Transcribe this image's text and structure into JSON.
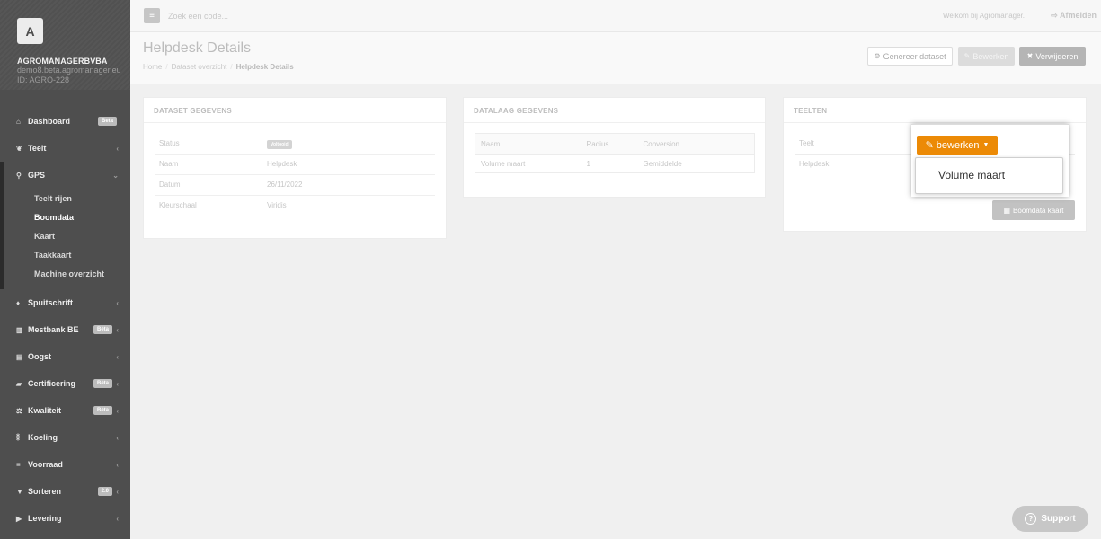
{
  "sidebar": {
    "logo": "A",
    "company": "AGROMANAGERBVBA",
    "email": "demo8.beta.agromanager.eu",
    "id": "ID: AGRO-228",
    "items": [
      {
        "label": "Dashboard",
        "badge": "Beta",
        "icon": "home-icon"
      },
      {
        "label": "Teelt",
        "icon": "leaf-icon"
      },
      {
        "label": "GPS",
        "icon": "map-marker-icon"
      },
      {
        "label": "Spuitschrift",
        "icon": "drop-icon"
      },
      {
        "label": "Mestbank BE",
        "badge": "Bèta",
        "icon": "bank-icon"
      },
      {
        "label": "Oogst",
        "icon": "basket-icon"
      },
      {
        "label": "Certificering",
        "badge": "Bèta",
        "icon": "book-icon"
      },
      {
        "label": "Kwaliteit",
        "badge": "Bèta",
        "icon": "balance-icon"
      },
      {
        "label": "Koeling",
        "icon": "thermometer-icon"
      },
      {
        "label": "Voorraad",
        "icon": "list-icon"
      },
      {
        "label": "Sorteren",
        "badge": "2.0",
        "icon": "filter-icon"
      },
      {
        "label": "Levering",
        "icon": "truck-icon"
      }
    ],
    "gps_sub": [
      "Teelt rijen",
      "Boomdata",
      "Kaart",
      "Taakkaart",
      "Machine overzicht"
    ]
  },
  "topbar": {
    "search_placeholder": "Zoek een code...",
    "welcome": "Welkom bij Agromanager.",
    "logout": "Afmelden"
  },
  "header": {
    "title": "Helpdesk Details",
    "crumbs": [
      "Home",
      "Dataset overzicht",
      "Helpdesk Details"
    ],
    "btn_generate": "Genereer dataset",
    "btn_edit": "Bewerken",
    "btn_delete": "Verwijderen"
  },
  "dataset": {
    "title": "DATASET GEGEVENS",
    "rows": [
      {
        "k": "Status",
        "v": "Voltooid"
      },
      {
        "k": "Naam",
        "v": "Helpdesk"
      },
      {
        "k": "Datum",
        "v": "26/11/2022"
      },
      {
        "k": "Kleurschaal",
        "v": "Viridis"
      }
    ]
  },
  "datalaag": {
    "title": "DATALAAG GEGEVENS",
    "headers": [
      "Naam",
      "Radius",
      "Conversion"
    ],
    "rows": [
      [
        "Volume maart",
        "1",
        "Gemiddelde"
      ]
    ]
  },
  "teelten": {
    "title": "TEELTEN",
    "header": "Teelt",
    "row": "Helpdesk",
    "map_button": "Boomdata kaart"
  },
  "dropdown": {
    "button": "bewerken",
    "item": "Volume maart",
    "color": "#ec8a06"
  },
  "support": "Support"
}
